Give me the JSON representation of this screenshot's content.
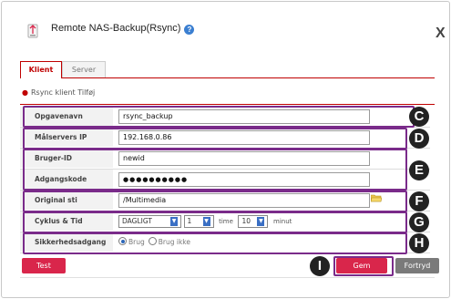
{
  "dialog": {
    "title": "Remote NAS-Backup(Rsync)",
    "help_icon": "?",
    "close_label": "X"
  },
  "tabs": [
    {
      "label": "Klient",
      "active": true
    },
    {
      "label": "Server",
      "active": false
    }
  ],
  "section": {
    "title": "Rsync klient Tilføj"
  },
  "form": {
    "task_name": {
      "label": "Opgavenavn",
      "value": "rsync_backup"
    },
    "target_ip": {
      "label": "Målservers IP",
      "value": "192.168.0.86"
    },
    "user_id": {
      "label": "Bruger-ID",
      "value": "newid"
    },
    "password": {
      "label": "Adgangskode",
      "value": "●●●●●●●●●●"
    },
    "source_path": {
      "label": "Original sti",
      "value": "/Multimedia"
    },
    "cycle": {
      "label": "Cyklus & Tid",
      "frequency": "DAGLIGT",
      "hour": "1",
      "hour_unit": "time",
      "minute": "10",
      "minute_unit": "minut"
    },
    "security": {
      "label": "Sikkerhedsadgang",
      "options": [
        "Brug",
        "Brug ikke"
      ],
      "selected": "Brug"
    }
  },
  "buttons": {
    "test": "Test",
    "save": "Gem",
    "cancel": "Fortryd"
  },
  "markers": [
    "C",
    "D",
    "E",
    "F",
    "G",
    "H",
    "I"
  ],
  "colors": {
    "accent": "#d9264b",
    "highlight": "#7a2b8a",
    "tab_active": "#c00000"
  }
}
